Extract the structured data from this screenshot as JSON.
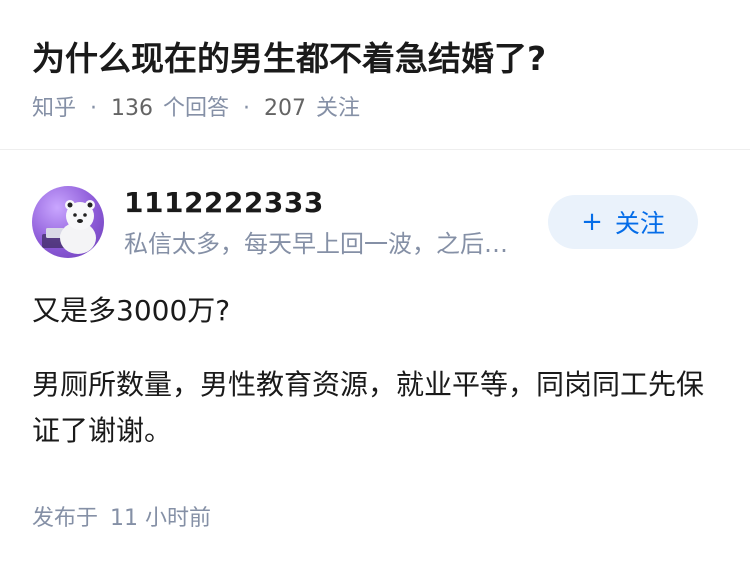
{
  "question": {
    "title": "为什么现在的男生都不着急结婚了?",
    "source": "知乎",
    "answers_count": "136",
    "answers_label": "个回答",
    "followers_count": "207",
    "followers_label": "关注",
    "separator": "·"
  },
  "author": {
    "name": "1112222333",
    "bio": "私信太多，每天早上回一波，之后…",
    "avatar": "avatar-bear-icon"
  },
  "follow_button": {
    "plus": "+",
    "label": "关注"
  },
  "answer": {
    "paragraphs": [
      "又是多3000万?",
      "男厕所数量，男性教育资源，就业平等，同岗同工先保证了谢谢。"
    ],
    "publish_label": "发布于",
    "publish_time": "11 小时前"
  },
  "colors": {
    "accent": "#056de8",
    "accent_bg": "#eaf2fb",
    "meta_gray": "#8590a6",
    "text": "#1a1a1a"
  }
}
